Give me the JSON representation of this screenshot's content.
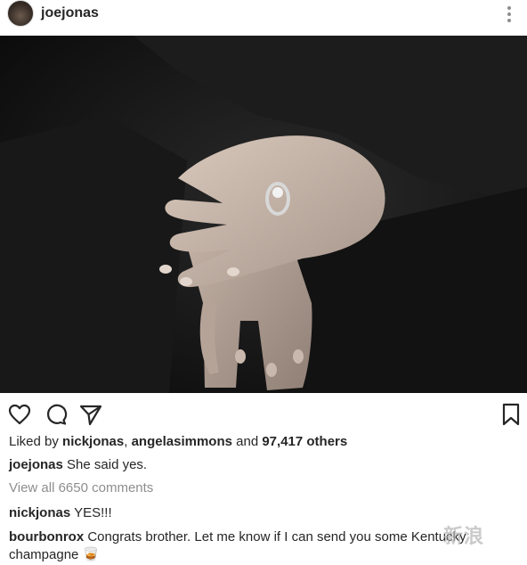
{
  "header": {
    "username": "joejonas",
    "more_icon": "more-vertical-icon"
  },
  "photo": {
    "description_hidden": ""
  },
  "actions": {
    "icons": [
      "heart-icon",
      "comment-icon",
      "share-icon",
      "bookmark-icon"
    ]
  },
  "likes": {
    "prefix": "Liked by ",
    "user1": "nickjonas",
    "separator": ", ",
    "user2": "angelasimmons",
    "and": " and ",
    "count": "97,417 others"
  },
  "caption": {
    "user": "joejonas",
    "text": "She said yes."
  },
  "view_all": "View all 6650 comments",
  "comments": [
    {
      "user": "nickjonas",
      "text": "YES!!!"
    },
    {
      "user": "bourbonrox",
      "text": "Congrats brother.  Let me know if I can send you some Kentucky champagne 🥃"
    }
  ],
  "watermark": "新浪"
}
